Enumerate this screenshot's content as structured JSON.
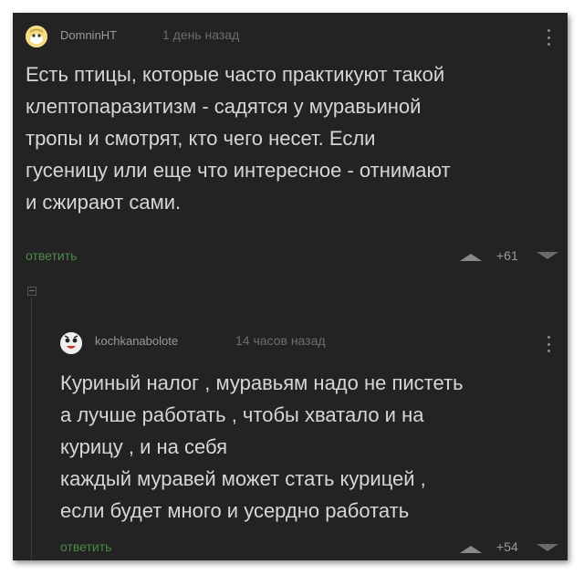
{
  "comments": [
    {
      "username": "DomninHT",
      "time": "1 день назад",
      "text": "Есть птицы, которые часто практикуют такой\nклептопаразитизм - садятся у муравьиной\nтропы и смотрят, кто чего несет. Если\nгусеницу или еще что интересное - отнимают\nи сжирают сами.",
      "reply_label": "ответить",
      "rating": "+61"
    },
    {
      "username": "kochkanabolote",
      "time": "14 часов назад",
      "text": "Куриный налог , муравьям надо не пистеть\nа лучше работать , чтобы хватало и на\nкурицу , и на себя\nкаждый муравей может стать курицей ,\nесли будет много и усердно работать",
      "reply_label": "ответить",
      "rating": "+54"
    }
  ],
  "colors": {
    "background": "#232323",
    "text": "#d6d6d6",
    "reply_link": "#4d8a47",
    "meta": "#9a9a9a"
  },
  "icons": {
    "avatar_1": "cartoon-character-avatar",
    "avatar_2": "bird-face-avatar",
    "menu": "kebab-menu-icon",
    "upvote": "triangle-up-icon",
    "downvote": "triangle-down-icon",
    "collapse": "collapse-thread-icon"
  }
}
